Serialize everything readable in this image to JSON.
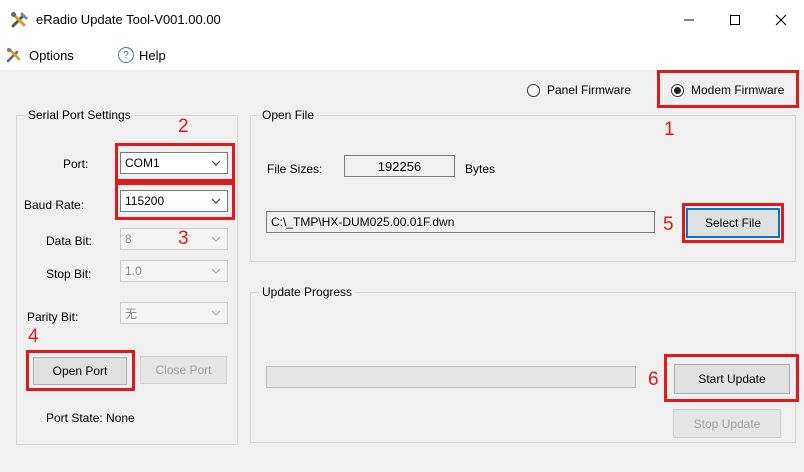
{
  "window": {
    "title": "eRadio Update Tool-V001.00.00",
    "controls": {
      "minimize": "—",
      "maximize": "☐",
      "close": "✕"
    }
  },
  "menu": {
    "options": "Options",
    "help": "Help",
    "help_glyph": "?"
  },
  "firmware_mode": {
    "panel": "Panel Firmware",
    "modem": "Modem Firmware",
    "selected": "modem"
  },
  "serial": {
    "group_title": "Serial Port Settings",
    "port": {
      "label": "Port:",
      "value": "COM1"
    },
    "baud": {
      "label": "Baud Rate:",
      "value": "115200"
    },
    "data_bit": {
      "label": "Data Bit:",
      "value": "8"
    },
    "stop_bit": {
      "label": "Stop Bit:",
      "value": "1.0"
    },
    "parity_bit": {
      "label": "Parity Bit:",
      "value": "无"
    },
    "open_port": "Open Port",
    "close_port": "Close Port",
    "port_state": "Port State: None"
  },
  "open_file": {
    "group_title": "Open File",
    "sizes_label": "File Sizes:",
    "sizes_value": "192256",
    "sizes_unit": "Bytes",
    "path": "C:\\_TMP\\HX-DUM025.00.01F.dwn",
    "select_file": "Select File"
  },
  "update": {
    "group_title": "Update Progress",
    "progress": 0,
    "start": "Start Update",
    "stop": "Stop Update"
  },
  "annotations": [
    "1",
    "2",
    "3",
    "4",
    "5",
    "6"
  ],
  "colors": {
    "annotation": "#e0191b",
    "focus": "#0078d7"
  }
}
